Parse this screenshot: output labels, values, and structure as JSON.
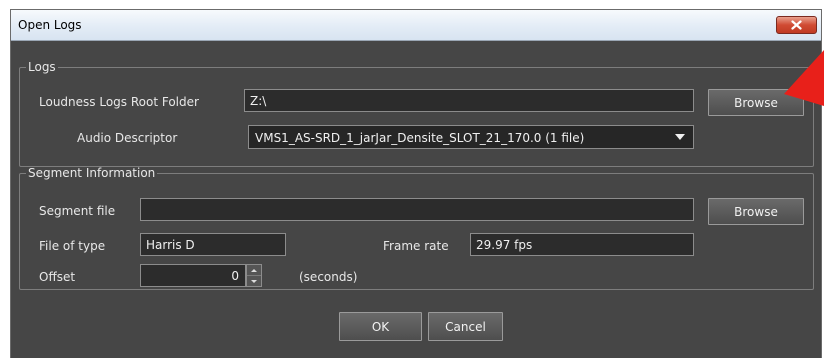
{
  "window": {
    "title": "Open Logs"
  },
  "logs": {
    "legend": "Logs",
    "root_folder_label": "Loudness Logs Root Folder",
    "root_folder_value": "Z:\\",
    "browse_label": "Browse",
    "audio_descriptor_label": "Audio Descriptor",
    "audio_descriptor_value": "VMS1_AS-SRD_1_jarJar_Densite_SLOT_21_170.0 (1 file)"
  },
  "segment": {
    "legend": "Segment Information",
    "segment_file_label": "Segment file",
    "segment_file_value": "",
    "browse_label": "Browse",
    "file_type_label": "File of type",
    "file_type_value": "Harris D",
    "frame_rate_label": "Frame rate",
    "frame_rate_value": "29.97 fps",
    "offset_label": "Offset",
    "offset_value": "0",
    "offset_unit": "(seconds)"
  },
  "footer": {
    "ok_label": "OK",
    "cancel_label": "Cancel"
  },
  "colors": {
    "dialog_bg": "#464646",
    "field_bg": "#2c2c2c",
    "close_button": "#d04b33",
    "annotation_arrow": "#e8201a"
  },
  "icons": {
    "close": "close-x-icon",
    "dropdown": "triangle-down-icon",
    "annotation": "red-arrow-icon"
  }
}
